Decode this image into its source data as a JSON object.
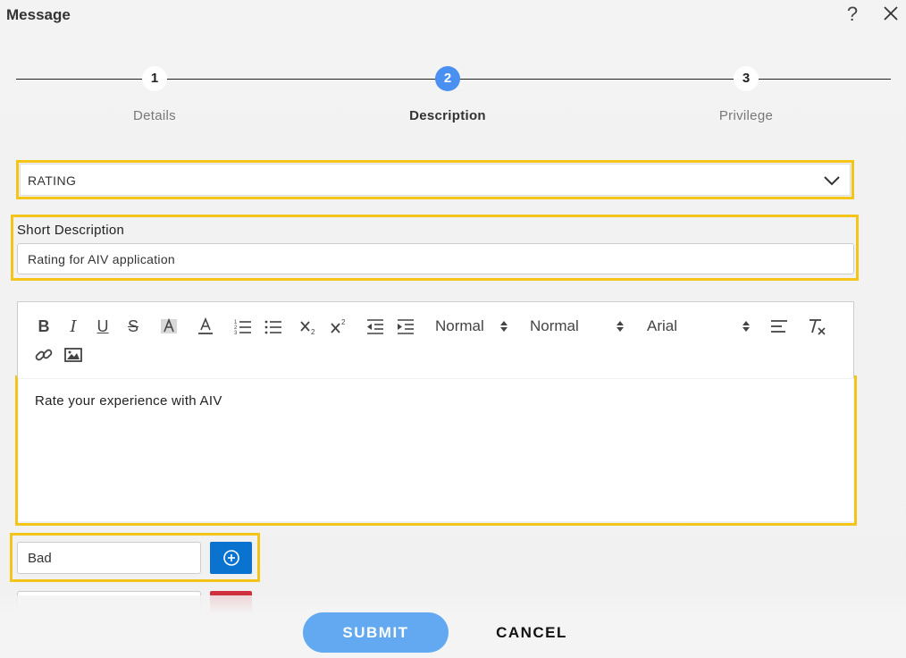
{
  "header": {
    "title": "Message"
  },
  "stepper": {
    "steps": [
      {
        "number": "1",
        "label": "Details"
      },
      {
        "number": "2",
        "label": "Description"
      },
      {
        "number": "3",
        "label": "Privilege"
      }
    ],
    "active_step": 2
  },
  "form": {
    "type_select": {
      "value": "RATING"
    },
    "short_description": {
      "label": "Short Description",
      "value": "Rating for AIV application"
    },
    "toolbar": {
      "header_picker": "Normal",
      "size_picker": "Normal",
      "font_picker": "Arial",
      "icons": [
        "bold-icon",
        "italic-icon",
        "underline-icon",
        "strike-icon",
        "background-color-icon",
        "text-color-icon",
        "ordered-list-icon",
        "bullet-list-icon",
        "subscript-icon",
        "superscript-icon",
        "outdent-icon",
        "indent-icon",
        "align-icon",
        "clear-format-icon",
        "link-icon",
        "image-icon"
      ]
    },
    "editor": {
      "content": "Rate your experience with AIV"
    },
    "options": [
      {
        "value": "Bad"
      }
    ]
  },
  "footer": {
    "submit_label": "SUBMIT",
    "cancel_label": "CANCEL"
  },
  "colors": {
    "accent": "#4a90f0",
    "highlight": "#f4c518",
    "add": "#0a73d0",
    "remove": "#cf2f3f",
    "submit": "#63a9f2"
  }
}
